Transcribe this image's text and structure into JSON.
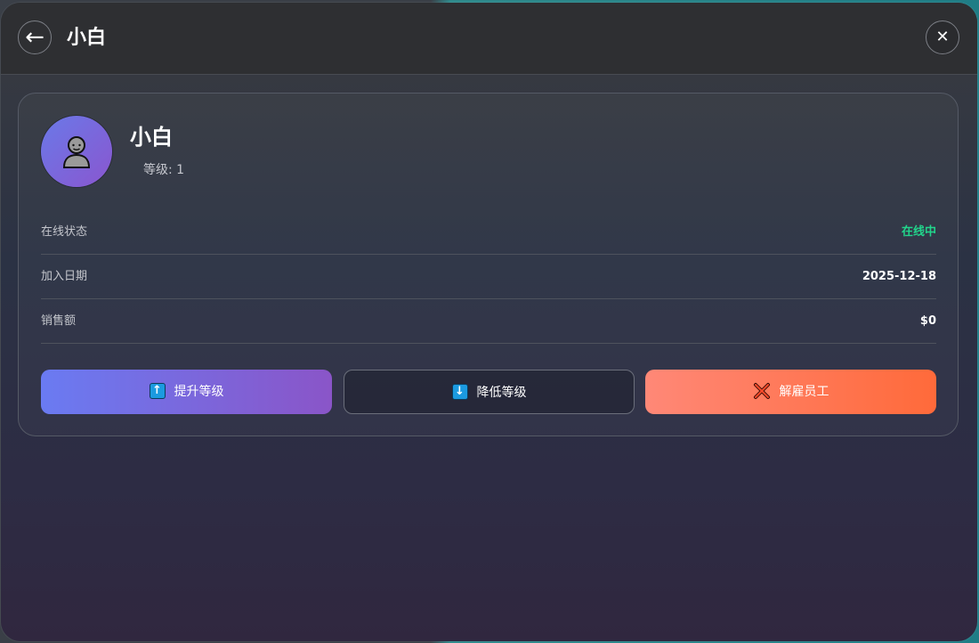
{
  "header": {
    "back_icon": "arrow-left-icon",
    "back_glyph": "←",
    "title": "小白",
    "close_icon": "close-icon",
    "close_glyph": "✕"
  },
  "profile": {
    "avatar_icon": "person-icon",
    "name": "小白",
    "level_text": "等级: 1"
  },
  "info": [
    {
      "label": "在线状态",
      "value": "在线中",
      "value_color": "#22d58b"
    },
    {
      "label": "加入日期",
      "value": "2025-12-18"
    },
    {
      "label": "销售额",
      "value": "$0"
    }
  ],
  "actions": {
    "promote": {
      "icon": "arrow-up-icon",
      "glyph": "↑",
      "label": "提升等级"
    },
    "demote": {
      "icon": "arrow-down-icon",
      "glyph": "↓",
      "label": "降低等级"
    },
    "fire": {
      "icon": "cross-icon",
      "label": "解雇员工"
    }
  },
  "colors": {
    "accent_purple": "#7b6be0",
    "online_green": "#22d58b",
    "fire_orange": "#ff6a3a"
  }
}
